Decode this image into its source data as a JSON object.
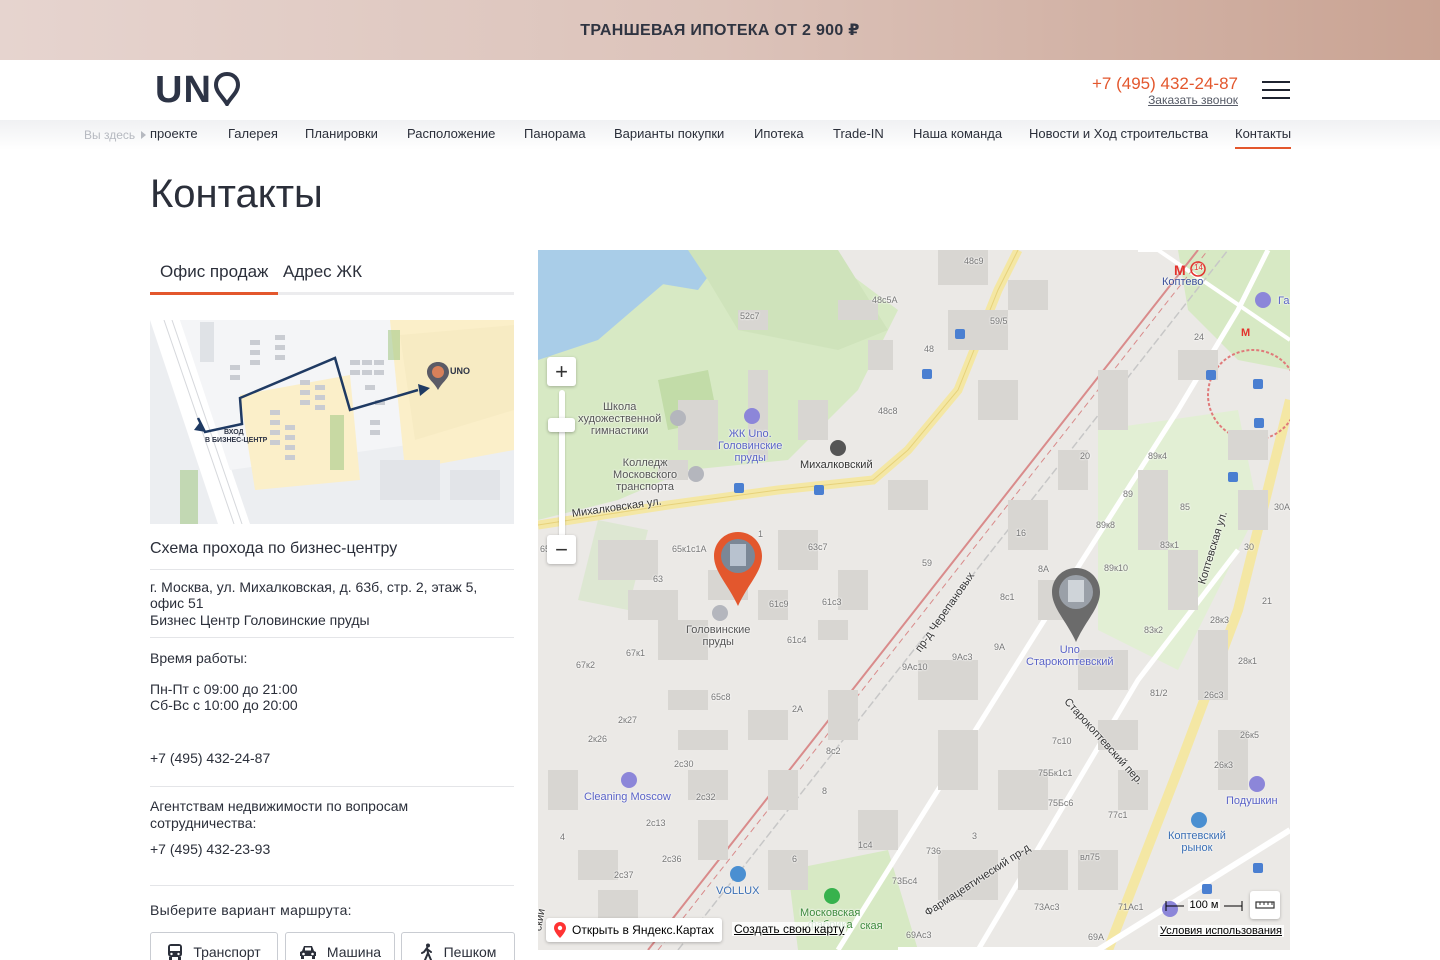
{
  "promo": {
    "text": "ТРАНШЕВАЯ ИПОТЕКА ОТ 2 900 ₽"
  },
  "header": {
    "logo_text": "UN",
    "phone": "+7 (495) 432-24-87",
    "callback": "Заказать звонок"
  },
  "nav": {
    "here": "Вы здесь",
    "items": [
      {
        "label": "проекте"
      },
      {
        "label": "Галерея"
      },
      {
        "label": "Планировки"
      },
      {
        "label": "Расположение"
      },
      {
        "label": "Панорама"
      },
      {
        "label": "Варианты покупки"
      },
      {
        "label": "Ипотека"
      },
      {
        "label": "Trade-IN"
      },
      {
        "label": "Наша команда"
      },
      {
        "label": "Новости и Ход строительства"
      },
      {
        "label": "Контакты"
      }
    ],
    "active": "Контакты"
  },
  "page": {
    "title": "Контакты"
  },
  "tabs": [
    {
      "label": "Офис продаж",
      "active": true
    },
    {
      "label": "Адрес ЖК",
      "active": false
    }
  ],
  "scheme": {
    "logo": "UNO",
    "entrance_line1": "ВХОД",
    "entrance_line2": "В БИЗНЕС-ЦЕНТР"
  },
  "office": {
    "caption": "Схема прохода по бизнес-центру",
    "address_line1": "г. Москва, ул. Михалковская, д. 63б, стр. 2, этаж 5,",
    "address_line2": "офис 51",
    "address_line3": "Бизнес Центр Головинские пруды",
    "hours_title": "Время работы:",
    "hours_weekdays": "Пн-Пт с 09:00 до 21:00",
    "hours_weekend": "Сб-Вс с 10:00 до 20:00",
    "phone": "+7 (495) 432-24-87",
    "agency_line1": "Агентствам недвижимости по вопросам",
    "agency_line2": "сотрудничества:",
    "agency_phone": "+7 (495) 432-23-93"
  },
  "route": {
    "title": "Выберите вариант маршрута:",
    "options": [
      {
        "label": "Транспорт",
        "icon": "bus-icon"
      },
      {
        "label": "Машина",
        "icon": "car-icon"
      },
      {
        "label": "Пешком",
        "icon": "walk-icon"
      }
    ]
  },
  "map": {
    "streets": {
      "mikhalkovskaya": "Михалковская ул.",
      "cherepanovykh": "пр-д Черепановых",
      "koptevskaya": "Коптевская ул.",
      "starokoptevsky": "Старокоптевский пер.",
      "farmatsevtichesky": "Фармацевтический пр-д"
    },
    "metro": {
      "name": "Коптево",
      "line": "14"
    },
    "pois": {
      "school": [
        "Школа",
        "художественной",
        "гимнастики"
      ],
      "college": [
        "Колледж",
        "Московского",
        "транспорта"
      ],
      "jk": [
        "ЖК Uno.",
        "Головинские",
        "пруды"
      ],
      "mikhalkovsky": "Михалковский",
      "office": [
        "Головинские",
        "пруды"
      ],
      "uno": [
        "Uno",
        "Старокоптевский"
      ],
      "cleaning": "Cleaning Moscow",
      "vollux": "VOLLUX",
      "factory": [
        "Московская",
        "фабрика"
      ],
      "koptevsky_market": [
        "Коптевский",
        "рынок"
      ],
      "podushkin": "Подушкин",
      "gas": "Га",
      "factory_tail": "ская"
    },
    "house_numbers": [
      "48с9",
      "48с5А",
      "52с7",
      "48",
      "48с8",
      "59/5",
      "24",
      "20",
      "89к4",
      "89",
      "85",
      "30А",
      "89к8",
      "89к10",
      "16",
      "83к1",
      "30",
      "21",
      "8А",
      "8с1",
      "65к1с1А",
      "63с7",
      "65",
      "63",
      "61с9",
      "61с3",
      "61с4",
      "59",
      "67к2",
      "67к1",
      "65с8",
      "9Ас10",
      "9Ас3",
      "9А",
      "83к2",
      "28к3",
      "28к1",
      "81/2",
      "26с3",
      "2А",
      "2к27",
      "2к26",
      "2с30",
      "2с32",
      "2с13",
      "2с36",
      "2с37",
      "8с2",
      "8",
      "6",
      "7с10",
      "75Бк1с1",
      "75Бс6",
      "77с1",
      "26к5",
      "26к3",
      "73Бс4",
      "73Ас3",
      "71Ас1",
      "69А",
      "69Ас3",
      "1с4",
      "3",
      "4",
      "736",
      "вл75",
      "1"
    ],
    "zoom_in": "+",
    "zoom_out": "−",
    "open_yandex": "Открыть в Яндекс.Картах",
    "create_map": "Создать свою карту",
    "scale": "100 м",
    "terms": "Условия использования",
    "street_fragment": "ский"
  }
}
